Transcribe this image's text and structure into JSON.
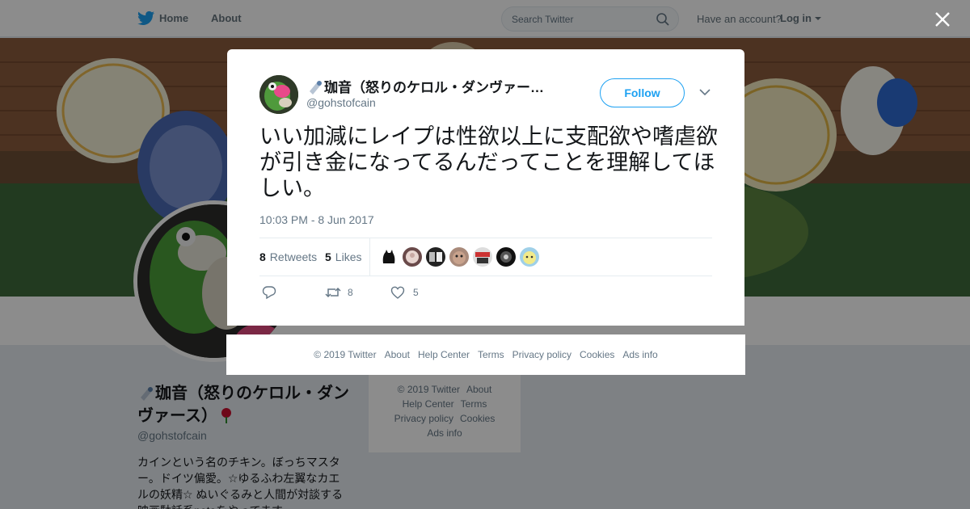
{
  "nav": {
    "home_label": "Home",
    "about_label": "About",
    "search_placeholder": "Search Twitter",
    "account_question": "Have an account?",
    "login_label": "Log in"
  },
  "profile": {
    "name": "珈音（怒りのケロル・ダンヴァース）",
    "handle": "@gohstofcain",
    "bio": "カインという名のチキン。ぼっちマスター。ドイツ偏愛。☆ゆるふわ左翼なカエルの妖精☆ ぬいぐるみと人間が対談する映画駄話系netaをやってます"
  },
  "profile_footer": {
    "items": [
      "© 2019 Twitter",
      "About",
      "Help Center",
      "Terms",
      "Privacy policy",
      "Cookies",
      "Ads info"
    ]
  },
  "tweet": {
    "author_name": "珈音（怒りのケロル・ダンヴァー…",
    "author_handle": "@gohstofcain",
    "follow_label": "Follow",
    "text": "いい加減にレイプは性欲以上に支配欲や嗜虐欲が引き金になってるんだってことを理解してほしい。",
    "timestamp": "10:03 PM - 8 Jun 2017",
    "retweets_count": "8",
    "retweets_label": "Retweets",
    "likes_count": "5",
    "likes_label": "Likes",
    "reply_count": "",
    "retweet_action_count": "8",
    "like_action_count": "5"
  },
  "modal_footer": {
    "items": [
      "© 2019 Twitter",
      "About",
      "Help Center",
      "Terms",
      "Privacy policy",
      "Cookies",
      "Ads info"
    ]
  },
  "colors": {
    "accent": "#1da1f2",
    "muted_text": "#657786",
    "overlay": "rgba(0,0,0,0.45)"
  },
  "icons": [
    "twitter-bird-icon",
    "search-icon",
    "caret-down-icon",
    "close-icon",
    "chevron-down-icon",
    "pin-icon",
    "reply-icon",
    "retweet-icon",
    "heart-icon",
    "rose-icon"
  ]
}
